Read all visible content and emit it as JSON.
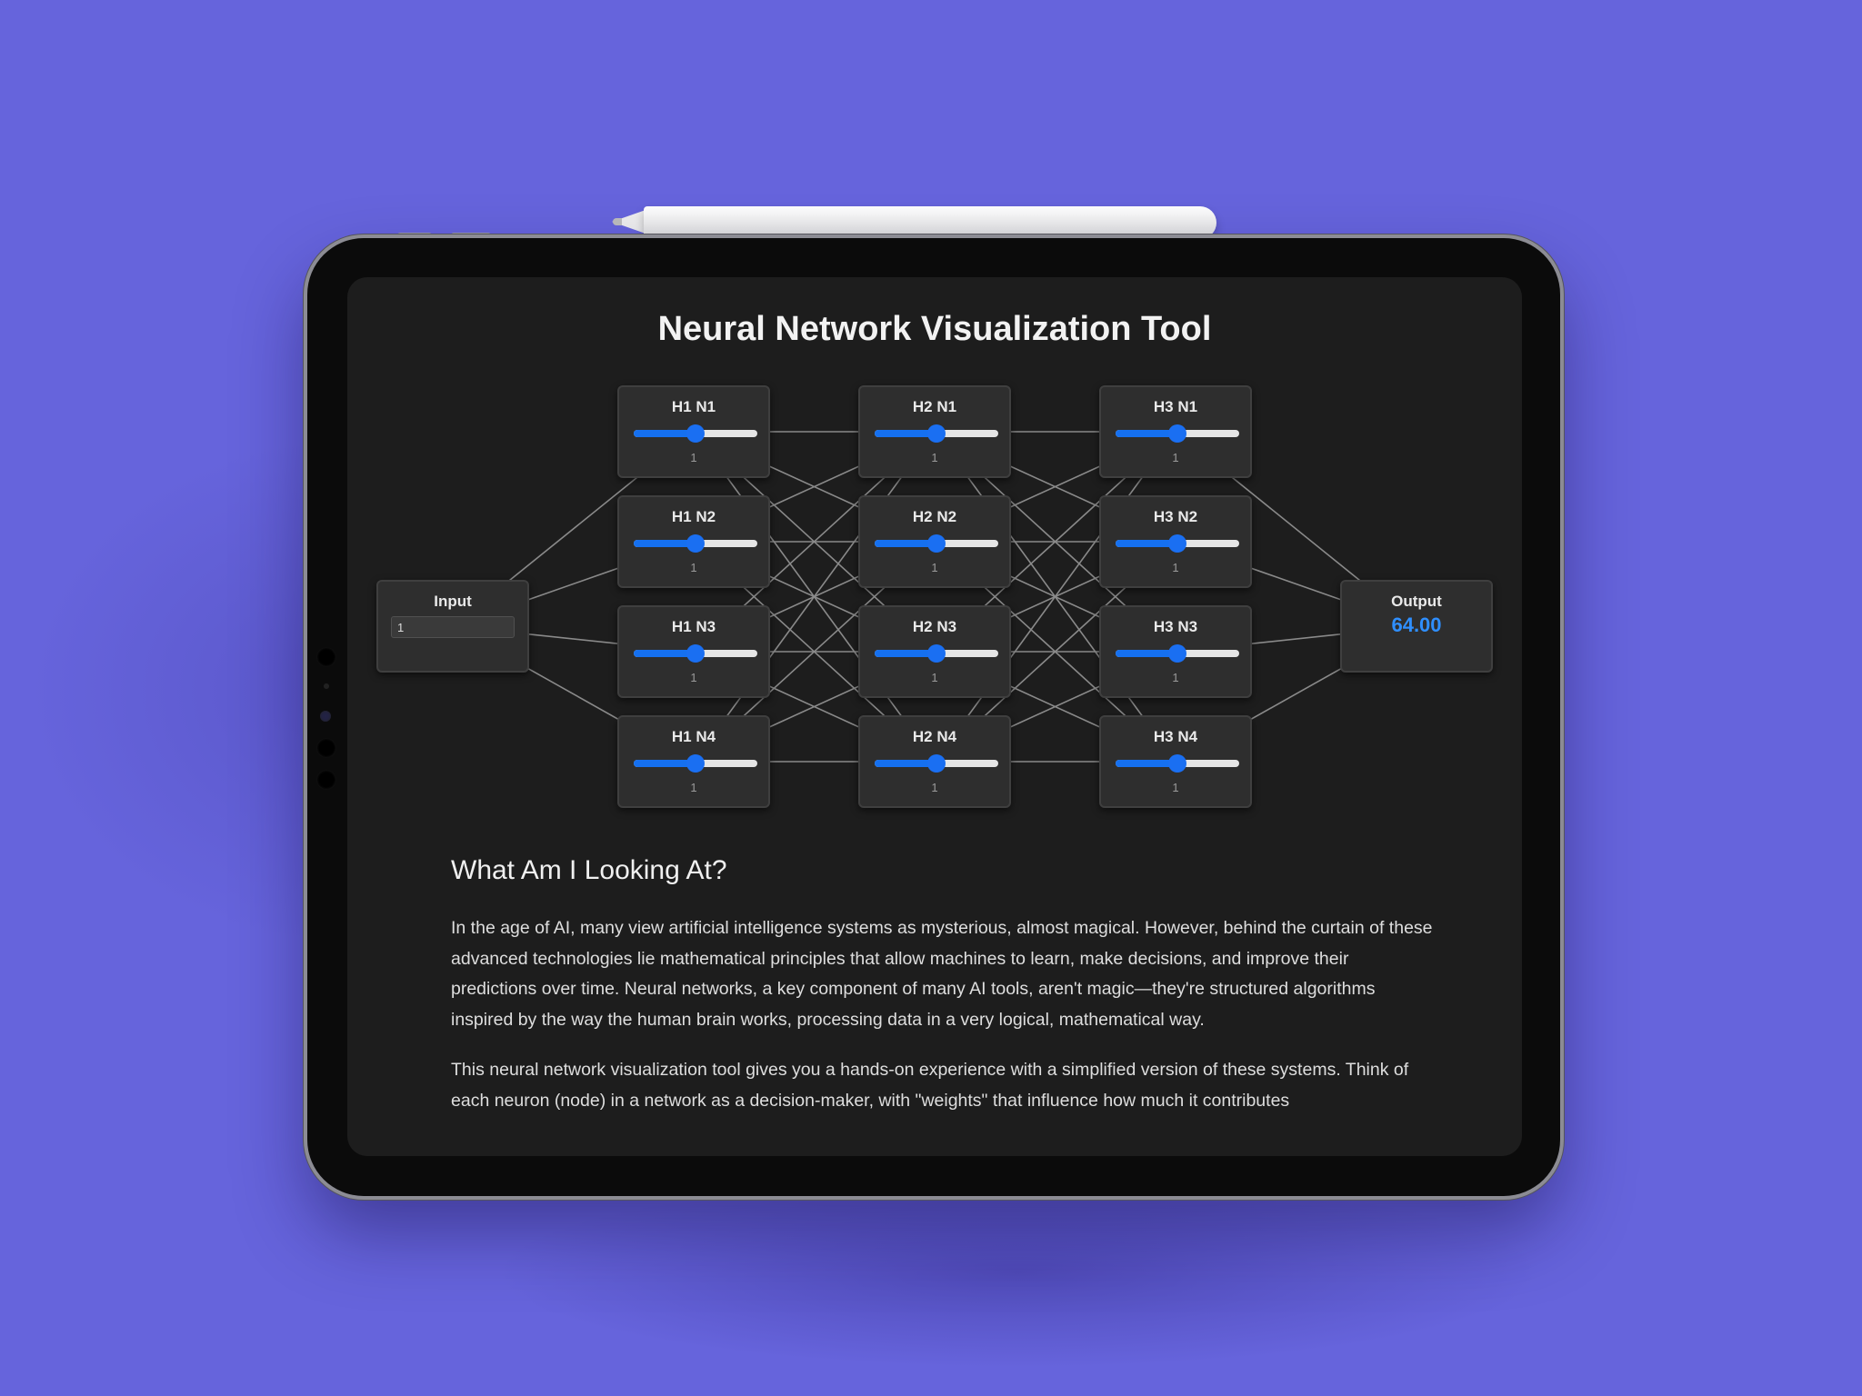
{
  "app": {
    "title": "Neural Network Visualization Tool"
  },
  "network": {
    "input": {
      "label": "Input",
      "value": "1"
    },
    "output": {
      "label": "Output",
      "value": "64.00"
    },
    "layers": [
      {
        "nodes": [
          {
            "label": "H1 N1",
            "weight": "1",
            "slider_fraction": 0.5
          },
          {
            "label": "H1 N2",
            "weight": "1",
            "slider_fraction": 0.5
          },
          {
            "label": "H1 N3",
            "weight": "1",
            "slider_fraction": 0.5
          },
          {
            "label": "H1 N4",
            "weight": "1",
            "slider_fraction": 0.5
          }
        ]
      },
      {
        "nodes": [
          {
            "label": "H2 N1",
            "weight": "1",
            "slider_fraction": 0.5
          },
          {
            "label": "H2 N2",
            "weight": "1",
            "slider_fraction": 0.5
          },
          {
            "label": "H2 N3",
            "weight": "1",
            "slider_fraction": 0.5
          },
          {
            "label": "H2 N4",
            "weight": "1",
            "slider_fraction": 0.5
          }
        ]
      },
      {
        "nodes": [
          {
            "label": "H3 N1",
            "weight": "1",
            "slider_fraction": 0.5
          },
          {
            "label": "H3 N2",
            "weight": "1",
            "slider_fraction": 0.5
          },
          {
            "label": "H3 N3",
            "weight": "1",
            "slider_fraction": 0.5
          },
          {
            "label": "H3 N4",
            "weight": "1",
            "slider_fraction": 0.5
          }
        ]
      }
    ]
  },
  "article": {
    "heading": "What Am I Looking At?",
    "paragraphs": [
      "In the age of AI, many view artificial intelligence systems as mysterious, almost magical. However, behind the curtain of these advanced technologies lie mathematical principles that allow machines to learn, make decisions, and improve their predictions over time. Neural networks, a key component of many AI tools, aren't magic—they're structured algorithms inspired by the way the human brain works, processing data in a very logical, mathematical way.",
      "This neural network visualization tool gives you a hands-on experience with a simplified version of these systems. Think of each neuron (node) in a network as a decision-maker, with \"weights\" that influence how much it contributes"
    ]
  },
  "colors": {
    "background": "#6664dc",
    "screen": "#1d1d1d",
    "accent": "#1a6ff2",
    "output_value": "#2f8fff",
    "link": "#8a8a8a"
  }
}
